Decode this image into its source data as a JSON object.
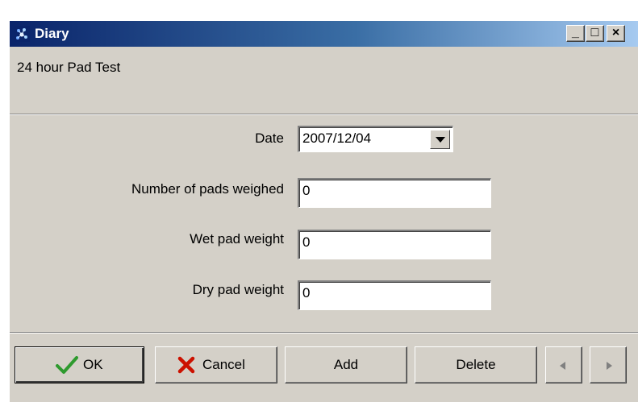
{
  "window": {
    "title": "Diary",
    "minimize_glyph": "_",
    "maximize_glyph": "□",
    "close_glyph": "×"
  },
  "header": {
    "subtitle": "24 hour Pad Test"
  },
  "form": {
    "date_label": "Date",
    "date_value": "2007/12/04",
    "pads_label": "Number of pads weighed",
    "pads_value": "0",
    "wet_label": "Wet pad weight",
    "wet_value": "0",
    "dry_label": "Dry pad weight",
    "dry_value": "0"
  },
  "buttons": {
    "ok_label": "OK",
    "cancel_label": "Cancel",
    "add_label": "Add",
    "delete_label": "Delete"
  },
  "icons": {
    "app": "diary-app-icon",
    "ok": "green-check-icon",
    "cancel": "red-x-icon",
    "prev": "prev-arrow-icon",
    "next": "next-arrow-icon"
  },
  "colors": {
    "titlebar_start": "#0a246a",
    "titlebar_end": "#a6caf0",
    "face": "#d4d0c8",
    "check_green": "#2e9a2e",
    "cancel_red": "#cc1100"
  }
}
